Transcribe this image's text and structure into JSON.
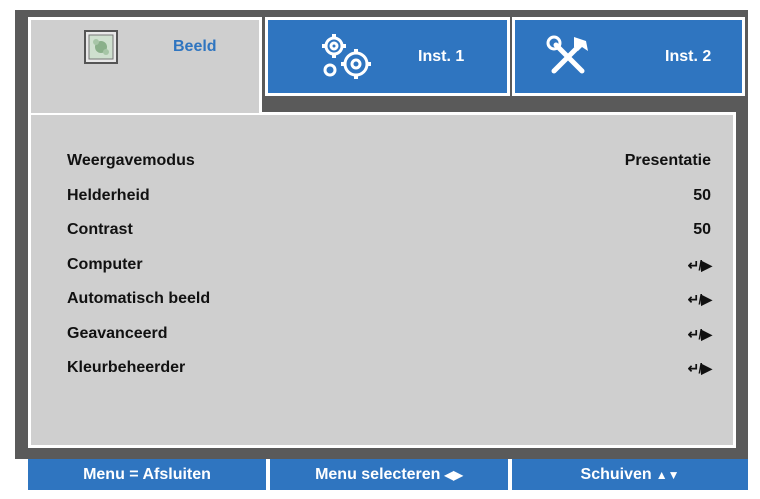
{
  "tabs": [
    {
      "label": "Beeld",
      "icon": "picture-icon",
      "active": true
    },
    {
      "label": "Inst. 1",
      "icon": "gears-icon",
      "active": false
    },
    {
      "label": "Inst. 2",
      "icon": "tools-icon",
      "active": false
    }
  ],
  "menu": {
    "items": [
      {
        "label": "Weergavemodus",
        "value": "Presentatie"
      },
      {
        "label": "Helderheid",
        "value": "50"
      },
      {
        "label": "Contrast",
        "value": "50"
      },
      {
        "label": "Computer",
        "value": "↵/▶"
      },
      {
        "label": "Automatisch beeld",
        "value": "↵/▶"
      },
      {
        "label": "Geavanceerd",
        "value": "↵/▶"
      },
      {
        "label": "Kleurbeheerder",
        "value": "↵/▶"
      }
    ]
  },
  "footer": {
    "exit_label": "Menu = Afsluiten",
    "select_label": "Menu selecteren",
    "select_glyphs": "◀▶",
    "scroll_label": "Schuiven",
    "scroll_glyphs": "▲▼"
  },
  "colors": {
    "accent_blue": "#2f75c0",
    "panel_gray": "#cfcfcf",
    "frame_gray": "#5a5a5a"
  }
}
